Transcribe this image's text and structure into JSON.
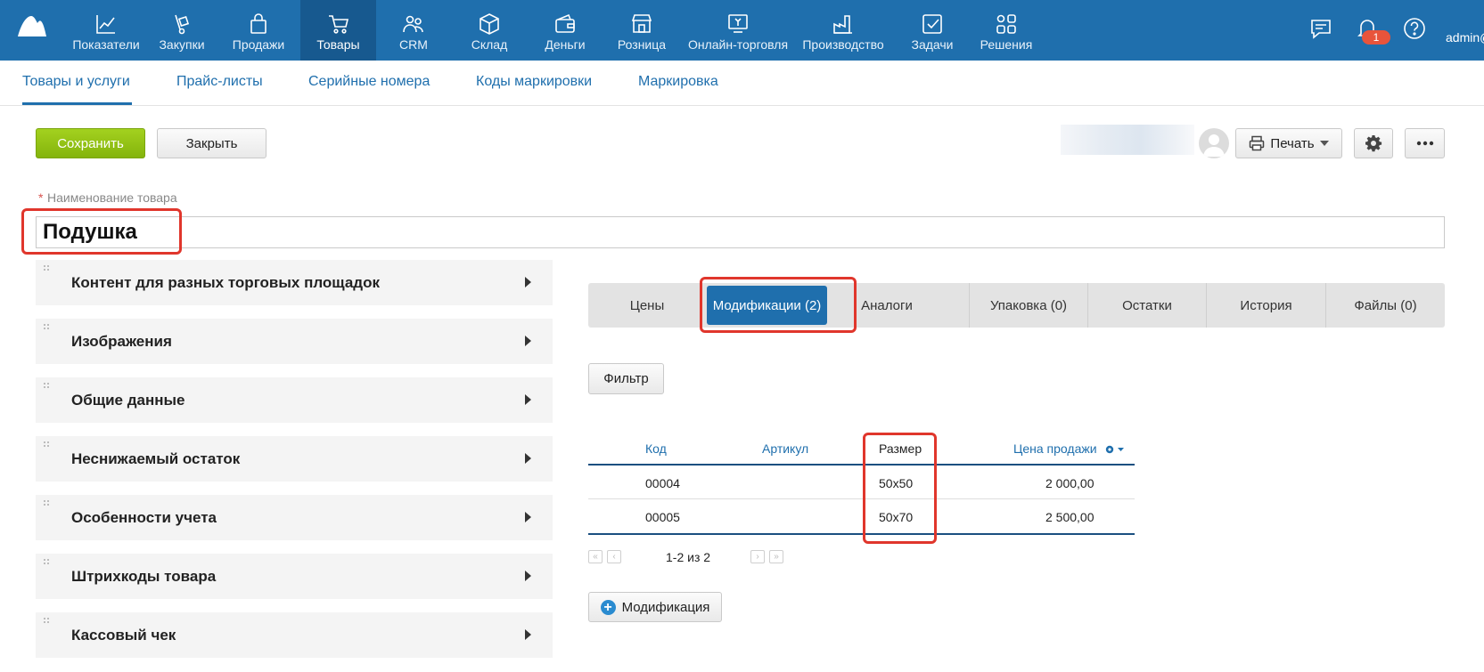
{
  "nav": {
    "items": [
      {
        "label": "Показатели",
        "icon": "chart-line-icon"
      },
      {
        "label": "Закупки",
        "icon": "dolly-icon"
      },
      {
        "label": "Продажи",
        "icon": "shopping-bag-icon"
      },
      {
        "label": "Товары",
        "icon": "cart-icon",
        "active": true
      },
      {
        "label": "CRM",
        "icon": "users-icon"
      },
      {
        "label": "Склад",
        "icon": "box-icon"
      },
      {
        "label": "Деньги",
        "icon": "wallet-icon"
      },
      {
        "label": "Розница",
        "icon": "store-icon"
      },
      {
        "label": "Онлайн-торговля",
        "icon": "online-shop-icon"
      },
      {
        "label": "Производство",
        "icon": "factory-icon"
      },
      {
        "label": "Задачи",
        "icon": "task-check-icon"
      },
      {
        "label": "Решения",
        "icon": "apps-grid-icon"
      }
    ],
    "notification_count": "1",
    "user": "admin@"
  },
  "subnav": {
    "items": [
      "Товары и услуги",
      "Прайс-листы",
      "Серийные номера",
      "Коды маркировки",
      "Маркировка"
    ]
  },
  "toolbar": {
    "save_label": "Сохранить",
    "close_label": "Закрыть",
    "print_label": "Печать"
  },
  "product": {
    "name_label": "Наименование товара",
    "name_value": "Подушка"
  },
  "sections": [
    "Контент для разных торговых площадок",
    "Изображения",
    "Общие данные",
    "Неснижаемый остаток",
    "Особенности учета",
    "Штрихкоды товара",
    "Кассовый чек"
  ],
  "tabs": [
    "Цены",
    "Модификации (2)",
    "Аналоги",
    "Упаковка (0)",
    "Остатки",
    "История",
    "Файлы (0)"
  ],
  "active_tab": "Модификации (2)",
  "filter_label": "Фильтр",
  "table": {
    "columns": [
      "Код",
      "Артикул",
      "Размер",
      "Цена продажи"
    ],
    "rows": [
      {
        "code": "00004",
        "article": "",
        "size": "50x50",
        "price": "2 000,00"
      },
      {
        "code": "00005",
        "article": "",
        "size": "50x70",
        "price": "2 500,00"
      }
    ]
  },
  "pager": {
    "text": "1-2 из 2"
  },
  "add_modification_label": "Модификация",
  "colors": {
    "brand": "#1f6fad",
    "save": "#8dbd14",
    "highlight": "#e0362c"
  }
}
